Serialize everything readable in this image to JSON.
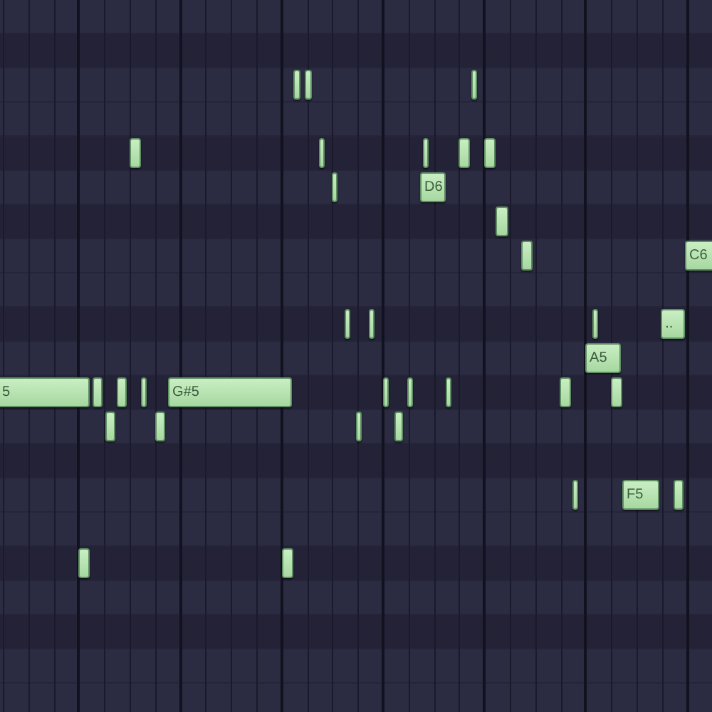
{
  "piano_roll": {
    "notes": [
      {
        "kind": "short"
      },
      {
        "kind": "short"
      },
      {
        "kind": "short"
      },
      {
        "kind": "short"
      },
      {
        "kind": "short"
      },
      {
        "kind": "short"
      },
      {
        "kind": "short"
      },
      {
        "kind": "short"
      },
      {
        "kind": "short"
      },
      {
        "kind": "labeled",
        "label": "D6"
      },
      {
        "kind": "short"
      },
      {
        "kind": "short"
      },
      {
        "kind": "labeled",
        "label": "C6"
      },
      {
        "kind": "short"
      },
      {
        "kind": "short"
      },
      {
        "kind": "short"
      },
      {
        "kind": "labeled",
        "label": ".."
      },
      {
        "kind": "labeled",
        "label": "A5"
      },
      {
        "kind": "labeled",
        "label": "5"
      },
      {
        "kind": "short"
      },
      {
        "kind": "short"
      },
      {
        "kind": "short"
      },
      {
        "kind": "labeled",
        "label": "G#5"
      },
      {
        "kind": "short"
      },
      {
        "kind": "short"
      },
      {
        "kind": "short"
      },
      {
        "kind": "short"
      },
      {
        "kind": "short"
      },
      {
        "kind": "short"
      },
      {
        "kind": "short"
      },
      {
        "kind": "short"
      },
      {
        "kind": "short"
      },
      {
        "kind": "short"
      },
      {
        "kind": "labeled",
        "label": "F5"
      },
      {
        "kind": "short"
      },
      {
        "kind": "short"
      },
      {
        "kind": "short"
      }
    ]
  }
}
